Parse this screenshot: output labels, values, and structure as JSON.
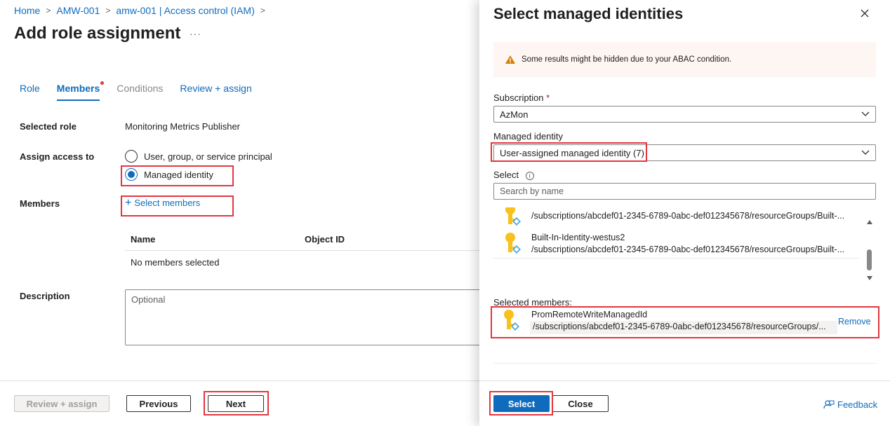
{
  "breadcrumb": [
    "Home",
    "AMW-001",
    "amw-001 | Access control (IAM)"
  ],
  "page": {
    "title": "Add role assignment",
    "more": "···"
  },
  "tabs": [
    {
      "label": "Role",
      "state": "link"
    },
    {
      "label": "Members",
      "state": "active"
    },
    {
      "label": "Conditions",
      "state": "disabled"
    },
    {
      "label": "Review + assign",
      "state": "link"
    }
  ],
  "form": {
    "selected_role_label": "Selected role",
    "selected_role_value": "Monitoring Metrics Publisher",
    "assign_access_label": "Assign access to",
    "option_user": "User, group, or service principal",
    "option_managed": "Managed identity",
    "members_label": "Members",
    "select_members": "Select members",
    "table_headers": [
      "Name",
      "Object ID"
    ],
    "no_members": "No members selected",
    "description_label": "Description",
    "description_placeholder": "Optional"
  },
  "footer": {
    "review_assign": "Review + assign",
    "previous": "Previous",
    "next": "Next"
  },
  "panel": {
    "title": "Select managed identities",
    "warning": "Some results might be hidden due to your ABAC condition.",
    "subscription_label": "Subscription",
    "subscription_required": "*",
    "subscription_value": "AzMon",
    "managed_identity_label": "Managed identity",
    "managed_identity_value": "User-assigned managed identity (7)",
    "select_label": "Select",
    "search_placeholder": "Search by name",
    "results": [
      {
        "name": "",
        "path": "/subscriptions/abcdef01-2345-6789-0abc-def012345678/resourceGroups/Built-..."
      },
      {
        "name": "Built-In-Identity-westus2",
        "path": "/subscriptions/abcdef01-2345-6789-0abc-def012345678/resourceGroups/Built-..."
      }
    ],
    "selected_members_label": "Selected members:",
    "selected": {
      "name": "PromRemoteWriteManagedId",
      "path": "/subscriptions/abcdef01-2345-6789-0abc-def012345678/resourceGroups/...",
      "remove": "Remove"
    },
    "select_button": "Select",
    "close_button": "Close",
    "feedback": "Feedback"
  },
  "colors": {
    "accent": "#0f6cbd",
    "highlight": "#e3363f",
    "warning_bg": "#fdf6f3",
    "warning_icon": "#d67f00",
    "key_icon": "#f8c11c"
  }
}
